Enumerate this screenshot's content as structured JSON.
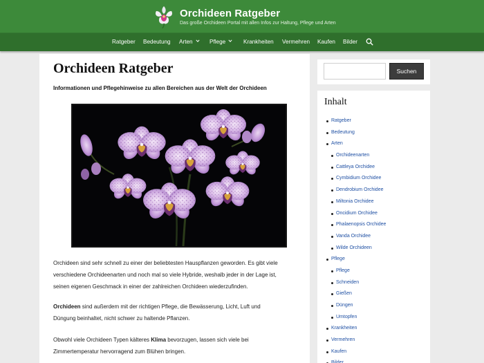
{
  "header": {
    "title": "Orchideen Ratgeber",
    "description": "Das große Orchideen Portal mit allen Infos zur Haltung, Pflege und Arten"
  },
  "nav": {
    "items": [
      {
        "label": "Ratgeber",
        "has_dropdown": false
      },
      {
        "label": "Bedeutung",
        "has_dropdown": false
      },
      {
        "label": "Arten",
        "has_dropdown": true
      },
      {
        "label": "Pflege",
        "has_dropdown": true
      },
      {
        "label": "Krankheiten",
        "has_dropdown": false
      },
      {
        "label": "Vermehren",
        "has_dropdown": false
      },
      {
        "label": "Kaufen",
        "has_dropdown": false
      },
      {
        "label": "Bilder",
        "has_dropdown": false
      }
    ],
    "search_icon": "search-icon"
  },
  "main": {
    "title": "Orchideen Ratgeber",
    "lead": "Informationen und Pflegehinweise zu allen Bereichen aus der Welt der Orchideen",
    "hero_image": "purple-orchid-photo",
    "paragraphs": [
      {
        "l1": "Orchideen sind sehr schnell zu einer der beliebtesten Hauspflanzen geworden. Es gibt viele",
        "l2": "verschiedene Orchideenarten und noch mal so viele Hybride, weshalb jeder in der Lage ist,",
        "l3": "seinen eigenen Geschmack in einer der zahlreichen Orchideen wiederzufinden."
      },
      {
        "bold": "Orchideen",
        "l1_rest": " sind außerdem mit der richtigen Pflege, die Bewässerung, Licht, Luft und",
        "l2": "Düngung beinhaltet, nicht schwer zu haltende Pflanzen."
      },
      {
        "l1_pre": "Obwohl viele Orchideen Typen kälteres ",
        "bold": "Klima",
        "l1_post": " bevorzugen, lassen sich viele bei",
        "l2": "Zimmertemperatur hervorragend zum Blühen bringen."
      }
    ]
  },
  "sidebar": {
    "search": {
      "placeholder": "",
      "value": "",
      "button_label": "Suchen"
    },
    "toc": {
      "title": "Inhalt",
      "items": [
        {
          "label": "Ratgeber",
          "level": 1
        },
        {
          "label": "Bedeutung",
          "level": 1
        },
        {
          "label": "Arten",
          "level": 1
        },
        {
          "label": "Orchideenarten",
          "level": 2
        },
        {
          "label": "Cattleya Orchidee",
          "level": 2
        },
        {
          "label": "Cymbidium Orchidee",
          "level": 2
        },
        {
          "label": "Dendrobium Orchidee",
          "level": 2
        },
        {
          "label": "Miltonia Orchidee",
          "level": 2
        },
        {
          "label": "Oncidium Orchidee",
          "level": 2
        },
        {
          "label": "Phalaenopsis Orchidee",
          "level": 2
        },
        {
          "label": "Vanda Orchidee",
          "level": 2
        },
        {
          "label": "Wilde Orchideen",
          "level": 2
        },
        {
          "label": "Pflege",
          "level": 1
        },
        {
          "label": "Pflege",
          "level": 2
        },
        {
          "label": "Schneiden",
          "level": 2
        },
        {
          "label": "Gießen",
          "level": 2
        },
        {
          "label": "Düngen",
          "level": 2
        },
        {
          "label": "Umtopfen",
          "level": 2
        },
        {
          "label": "Krankheiten",
          "level": 1
        },
        {
          "label": "Vermehren",
          "level": 1
        },
        {
          "label": "Kaufen",
          "level": 1
        },
        {
          "label": "Bilder",
          "level": 1
        }
      ]
    }
  },
  "colors": {
    "header_green": "#3d8a3a",
    "nav_green": "#2f6f2c",
    "link_blue": "#1e4fa3",
    "button_dark": "#3c3c3c"
  }
}
